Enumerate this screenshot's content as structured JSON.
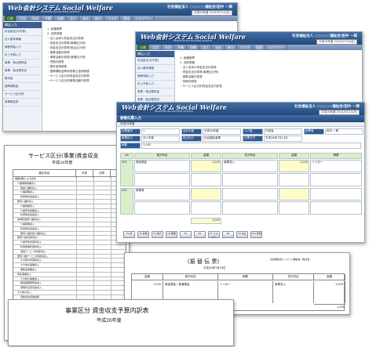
{
  "brand": {
    "logo": "Web会計システム Social Welfare",
    "tagline": "financial accounting system"
  },
  "org_name": "社会福祉法人 ○○○○○福祉会/田中 一郎",
  "date_label": "平成26年度 2014/07/14(月)",
  "menu": [
    "日常",
    "月次",
    "年次",
    "予算",
    "決算",
    "法人",
    "支払",
    "給与",
    "マスタ",
    "管理",
    "ログアウト"
  ],
  "sidebar": {
    "heading": "補足入力",
    "items": [
      "科目設定(対予算)",
      "法人基本情報",
      "期首残高入力",
      "計上予算入力",
      "事業・拠点間資金",
      "事業・拠点間未収",
      "基本金",
      "国庫補助金",
      "サービス区分別",
      "事業報告書"
    ]
  },
  "window1_lines": [
    "1. 各種帳票",
    "2. 決算書類",
    "・法人全体の資金収支計算書",
    "・資金収支計算書(事業区分別)",
    "・資金収支計算書(拠点区分別)",
    "・事業活動計算書",
    "・事業活動計算書(事業区分別)",
    "・貸借対照表",
    "・基本金明細書",
    "・国庫補助金等特別積立金明細書",
    "・サービス区分別資金収支内訳表",
    "・サービス区分別事業活動内訳表"
  ],
  "window2_lines": [
    "1. 各種帳票",
    "2. 決算書類",
    "・法人全体の資金収支計算書",
    "・資金収支計算書(事業区分別)",
    "・事業活動計算書",
    "・貸借対照表",
    "・サービス区分別資金収支内訳表"
  ],
  "entry": {
    "title": "振替伝票入力",
    "sub": "平成26年度",
    "labels": [
      "伝票番号",
      "会計年度",
      "入力者",
      "起票者",
      "事業区分",
      "拠点区分",
      "伝票日付",
      "摘要"
    ],
    "values": [
      "1",
      "平成26年度",
      "作成者",
      "田中 一郎",
      "法人本部",
      "社会福祉事業",
      "平成26年7月14日",
      "1,000"
    ],
    "table_headers": [
      "No",
      "借方科目",
      "金額",
      "貸方科目",
      "金額",
      "摘要"
    ],
    "rows": [
      {
        "no": "001",
        "debit": "現金預金",
        "amount_d": "1,000",
        "credit": "事業収入",
        "amount_c": "1,000",
        "memo": "ハイボー"
      },
      {
        "no": "002",
        "debit": "事業費",
        "amount_d": "",
        "credit": "",
        "amount_c": "",
        "memo": ""
      }
    ],
    "total": "1,000",
    "fkeys": [
      "F1 閉",
      "F2 新規",
      "F3 前行",
      "F4 明細",
      "F5 ",
      "F6 ",
      "F7 スキャン",
      "F8 ",
      "F9 中止",
      "F10 登録"
    ]
  },
  "report1": {
    "title": "サービス区分(事業)資金収支",
    "year": "平成26年度",
    "col_headers": [
      "勘定科目",
      "予算",
      "決算",
      "差異"
    ],
    "rows": [
      "事業活動による収支",
      "介護保険事業収入",
      "施設介護料収入",
      "介護報酬収入",
      "利用者負担金収入",
      "居宅介護料収入",
      "介護報酬収入",
      "介護予防報酬収入",
      "利用者負担金収入",
      "地域密着型介護料収入",
      "介護報酬収入",
      "利用者負担金収入",
      "居宅介護支援介護料収入",
      "居宅介護支援料収入",
      "介護予防支援料収入",
      "利用者等利用料収入",
      "施設サービス利用料収入",
      "居宅介護サービス利用料収入",
      "その他の利用料収入",
      "その他の事業収入",
      "補助金事業収入",
      "受託事業収入",
      "その他の事業収入",
      "経常経費寄附金収入",
      "受取利息配当金収入",
      "その他の収入",
      "流動資産評価益等",
      "事業活動収入計(1)",
      "人件費支出",
      "役員報酬支出",
      "職員給料支出",
      "職員賞与支出",
      "非常勤職員給与支出",
      "派遣職員費支出",
      "退職給付支出",
      "法定福利費支出"
    ]
  },
  "report2": {
    "title": "(振 替 伝 票)",
    "date": "平成26年7月14日",
    "org": "社会福祉法人 ○○○○福祉会 / 拠点名",
    "headers": [
      "金額",
      "借方科目",
      "摘要",
      "貸方科目",
      "金額"
    ],
    "line": {
      "amount_d": "1,000",
      "debit": "現金預金 / 普通預金",
      "memo": "ハイボー",
      "credit": "事業収入",
      "amount_c": "1,000"
    },
    "total_d": "1,000",
    "total_c": "1,000"
  },
  "report3": {
    "title": "事業区分 資金収支予算内訳表",
    "year": "平成26年度"
  }
}
